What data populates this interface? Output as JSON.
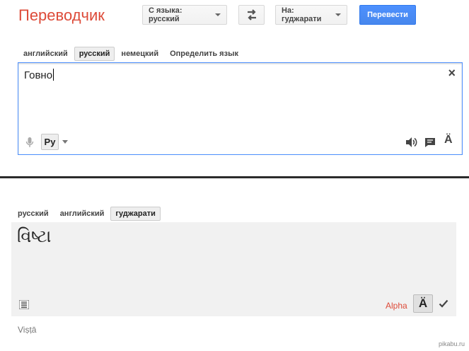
{
  "header": {
    "logo": "Переводчик",
    "source_lang_dropdown": "С языка: русский",
    "target_lang_dropdown": "На: гуджарати",
    "translate_button": "Перевести"
  },
  "source": {
    "tabs": [
      {
        "label": "английский",
        "selected": false
      },
      {
        "label": "русский",
        "selected": true
      },
      {
        "label": "немецкий",
        "selected": false
      },
      {
        "label": "Определить язык",
        "selected": false
      }
    ],
    "text": "Говно",
    "clear_icon": "×",
    "ime_label": "Ру",
    "font_icon": "Ä",
    "icons": [
      "microphone-icon",
      "chevron-down-icon",
      "speaker-icon",
      "chat-bubble-icon",
      "font-icon"
    ]
  },
  "result": {
    "tabs": [
      {
        "label": "русский",
        "selected": false
      },
      {
        "label": "английский",
        "selected": false
      },
      {
        "label": "гуджарати",
        "selected": true
      }
    ],
    "text": "વિષ્ટા",
    "alpha": "Alpha",
    "font_icon": "Ä",
    "transliteration": "Viṣṭā",
    "icons": [
      "list-icon",
      "font-icon",
      "checkmark-icon"
    ]
  },
  "watermark": "pikabu.ru",
  "colors": {
    "logo_red": "#dd4b39",
    "accent_blue": "#4d90fe",
    "result_bg": "#f1f1f1"
  }
}
